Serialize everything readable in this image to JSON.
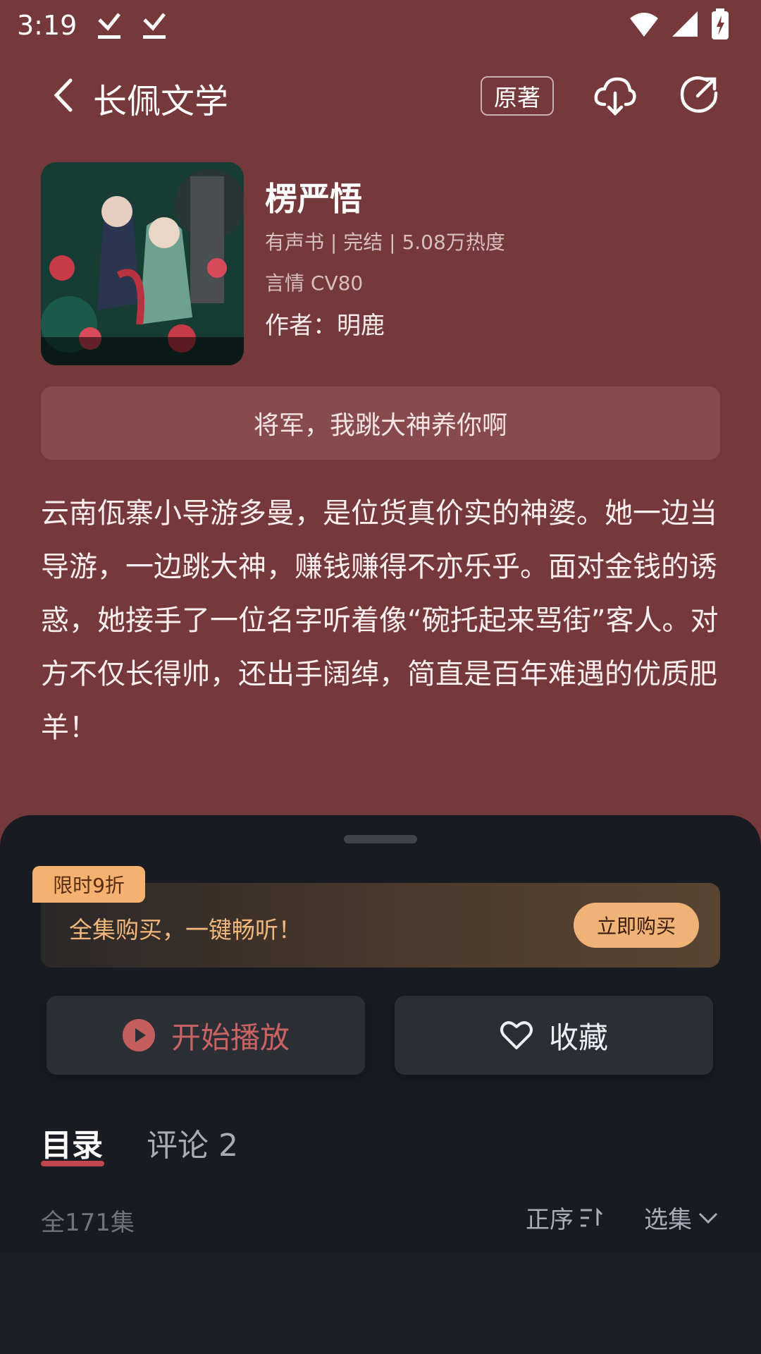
{
  "status": {
    "time": "3:19"
  },
  "header": {
    "title": "长佩文学",
    "original_label": "原著"
  },
  "book": {
    "title": "楞严悟",
    "meta": "有声书 | 完结 | 5.08万热度",
    "tags": "言情  CV80",
    "author": "作者：明鹿",
    "series_label": "将军，我跳大神养你啊",
    "summary": "云南佤寨小导游多曼，是位货真价实的神婆。她一边当导游，一边跳大神，赚钱赚得不亦乐乎。面对金钱的诱惑，她接手了一位名字听着像“碗托起来骂街”客人。对方不仅长得帅，还出手阔绰，简直是百年难遇的优质肥羊！"
  },
  "promo": {
    "badge": "限时9折",
    "text": "全集购买，一键畅听！",
    "buy_label": "立即购买"
  },
  "actions": {
    "play_label": "开始播放",
    "favorite_label": "收藏"
  },
  "tabs": {
    "catalog": "目录",
    "comments": "评论 2"
  },
  "episodes": {
    "count": "全171集",
    "order": "正序",
    "select": "选集"
  },
  "colors": {
    "background": "#75383b",
    "accent": "#c1464d",
    "promo_gold": "#f0b276"
  }
}
